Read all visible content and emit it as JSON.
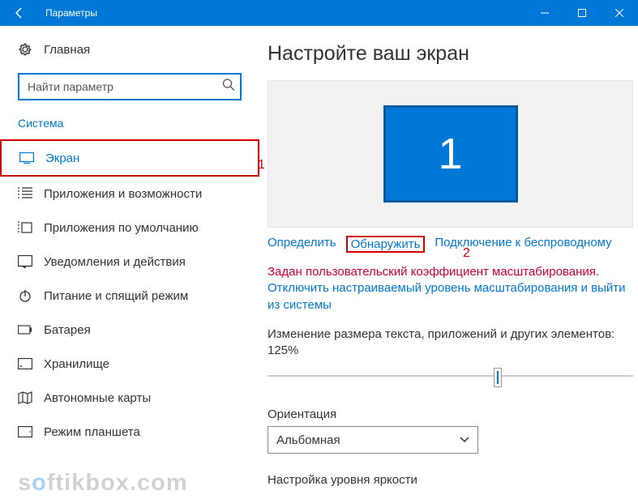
{
  "titlebar": {
    "title": "Параметры"
  },
  "sidebar": {
    "home": "Главная",
    "search_placeholder": "Найти параметр",
    "category": "Система",
    "items": [
      {
        "label": "Экран"
      },
      {
        "label": "Приложения и возможности"
      },
      {
        "label": "Приложения по умолчанию"
      },
      {
        "label": "Уведомления и действия"
      },
      {
        "label": "Питание и спящий режим"
      },
      {
        "label": "Батарея"
      },
      {
        "label": "Хранилище"
      },
      {
        "label": "Автономные карты"
      },
      {
        "label": "Режим планшета"
      }
    ]
  },
  "main": {
    "heading": "Настройте ваш экран",
    "monitor_number": "1",
    "links": {
      "identify": "Определить",
      "detect": "Обнаружить",
      "wireless": "Подключение к беспроводному"
    },
    "warning": "Задан пользовательский коэффициент масштабирования.",
    "advice": "Отключить настраиваемый уровень масштабирования и выйти из системы",
    "scale_label": "Изменение размера текста, приложений и других элементов: 125%",
    "orientation_label": "Ориентация",
    "orientation_value": "Альбомная",
    "brightness_label": "Настройка уровня яркости"
  },
  "annotations": {
    "one": "1",
    "two": "2"
  },
  "watermark": {
    "pre": "s",
    "o": "o",
    "post": "ftikbox.com"
  }
}
